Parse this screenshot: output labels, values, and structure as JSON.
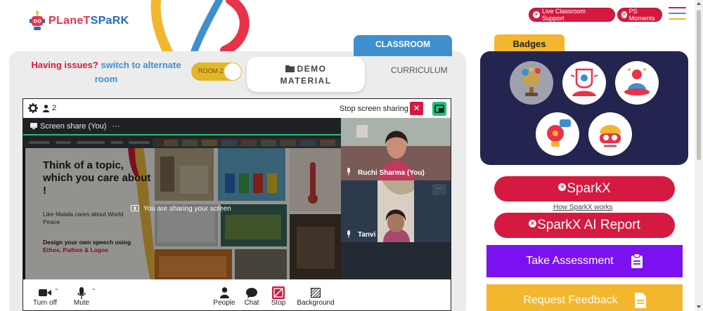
{
  "brand": {
    "logo_text_planet": "PLaneT",
    "logo_text_spark": "SPaRK"
  },
  "header": {
    "live_support_label": "Live Classroom Support",
    "ps_moments_label": "PS Moments",
    "accent_red": "#d6193f",
    "menu_colors": [
      "#d6193f",
      "#3f8fcf",
      "#f2b72e"
    ]
  },
  "classroom": {
    "tab_label": "CLASSROOM",
    "issues_text": "Having issues?",
    "switch_text": "switch to alternate room",
    "room_toggle_label": "ROOM 2",
    "demo_material_line1": "DEMO",
    "demo_material_line2": "MATERIAL",
    "curriculum_label": "CURRICULUM"
  },
  "call": {
    "participant_count": "2",
    "stop_sharing_label": "Stop screen sharing",
    "share_tab_label": "Screen share (You)",
    "share_tab_more": "···",
    "sharing_notice": "You are sharing your screen",
    "slide": {
      "heading": "Think of a topic, which you care about !",
      "body1": "Like Malala cares about World Peace",
      "body2_prefix": "Design your own speech using",
      "body2_highlight": "Ethos, Pathos & Logos"
    },
    "participants": [
      {
        "name": "Ruchi Sharma (You)"
      },
      {
        "name": "Tanvi"
      }
    ],
    "tile_more": "···",
    "controls": {
      "camera": "Turn off",
      "mic": "Mute",
      "people": "People",
      "chat": "Chat",
      "stop": "Stop",
      "background": "Background"
    }
  },
  "sidebar": {
    "badges_label": "Badges",
    "sparkx_label": "SparkX",
    "how_sparkx_label": "How SparkX works",
    "sparkx_ai_label": "SparkX AI Report",
    "take_assessment_label": "Take Assessment",
    "request_feedback_label": "Request Feedback",
    "assessment_color": "#7b10f0",
    "feedback_color": "#f2b72e"
  }
}
